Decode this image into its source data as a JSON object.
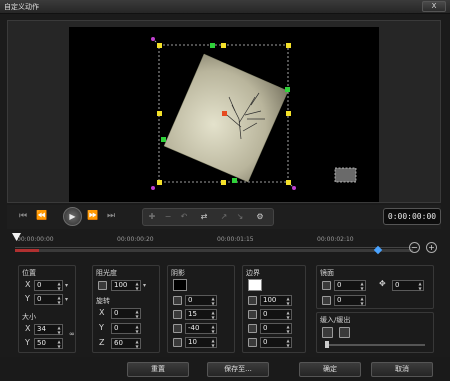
{
  "window": {
    "title": "自定义动作",
    "close_label": "X"
  },
  "transport": {
    "timecode": "0:00:00:00"
  },
  "timeline": {
    "ticks": [
      "00:00:00:00",
      "00:00:00:20",
      "00:00:01:15",
      "00:00:02:10"
    ]
  },
  "position": {
    "title": "位置",
    "x_label": "X",
    "x_value": "0",
    "y_label": "Y",
    "y_value": "0"
  },
  "size": {
    "title": "大小",
    "x_label": "X",
    "x_value": "34",
    "y_label": "Y",
    "y_value": "50"
  },
  "opacity": {
    "title": "阻光度",
    "value": "100"
  },
  "rotation": {
    "title": "旋转",
    "x_label": "X",
    "x_value": "0",
    "y_label": "Y",
    "y_value": "0",
    "z_label": "Z",
    "z_value": "60"
  },
  "shadow": {
    "title": "阴影",
    "color": "#000000",
    "opacity_value": "0",
    "blur_value": "15",
    "angle_value": "-40",
    "distance_value": "10"
  },
  "border": {
    "title": "边界",
    "color": "#ffffff",
    "opacity_value": "100",
    "width_value": "0",
    "soft_value": "0",
    "size_value": "0"
  },
  "mirror": {
    "title": "镜面",
    "opacity_value": "0",
    "distance_value": "0",
    "offset_value": "0"
  },
  "easing": {
    "title": "缓入/缓出"
  },
  "buttons": {
    "reset": "重置",
    "save_as": "保存至...",
    "ok": "确定",
    "cancel": "取消"
  }
}
